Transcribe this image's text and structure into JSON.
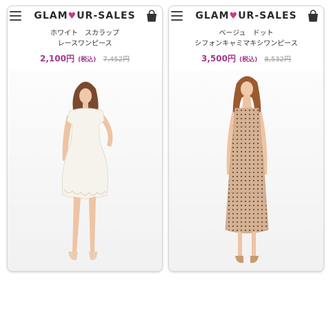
{
  "brand": {
    "prefix": "GLAM",
    "heart": "♥",
    "suffix": "UR-SALES",
    "accent_color": "#c9398f"
  },
  "products": [
    {
      "name": "ホワイト　スカラップ\nレースワンピース",
      "price": "2,100円",
      "tax_label": "(税込)",
      "original_price": "7,452円"
    },
    {
      "name": "ベージュ　ドット\nシフォンキャミマキシワンピース",
      "price": "3,500円",
      "tax_label": "(税込)",
      "original_price": "8,532円"
    }
  ],
  "icons": {
    "menu": "hamburger-menu-icon",
    "cart": "shopping-bag-icon"
  },
  "colors": {
    "price": "#a2388e",
    "original_price": "#999999"
  }
}
